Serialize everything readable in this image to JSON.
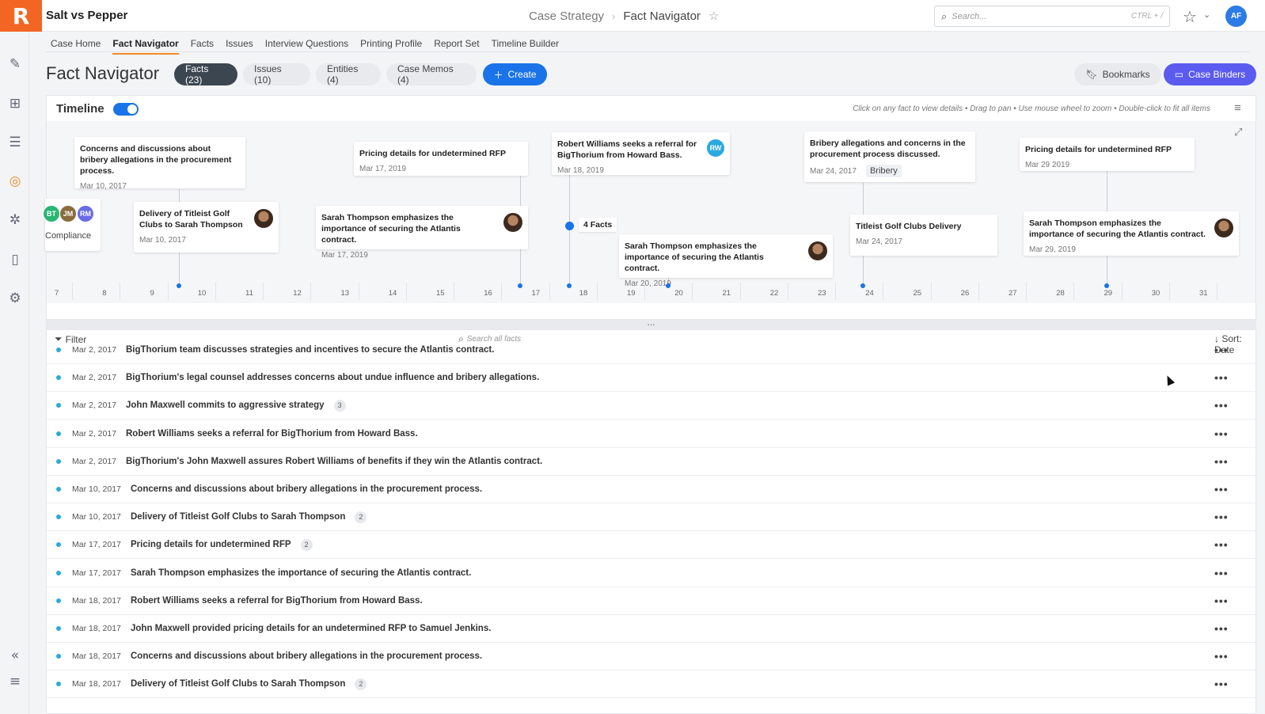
{
  "app": {
    "logo": "R",
    "title": "Salt vs Pepper"
  },
  "breadcrumb": {
    "parent": "Case Strategy",
    "current": "Fact Navigator"
  },
  "search": {
    "placeholder": "Search...",
    "shortcut": "CTRL + /"
  },
  "user": {
    "initials": "AF"
  },
  "nav_tabs": [
    "Case Home",
    "Fact Navigator",
    "Facts",
    "Issues",
    "Interview Questions",
    "Printing Profile",
    "Report Set",
    "Timeline Builder"
  ],
  "page": {
    "title": "Fact Navigator",
    "pills": [
      "Facts (23)",
      "Issues (10)",
      "Entities (4)",
      "Case Memos (4)"
    ],
    "create_label": "Create",
    "bookmarks_label": "Bookmarks",
    "binders_label": "Case Binders"
  },
  "timeline": {
    "title": "Timeline",
    "hint": "Click on any fact to view details • Drag to pan • Use mouse wheel to zoom • Double-click to fit all items",
    "partial_card": {
      "label": "Compliance",
      "avatars": [
        "BT",
        "JM",
        "RM"
      ]
    },
    "cards": [
      {
        "text": "Concerns and discussions about bribery allegations in the procurement process.",
        "date": "Mar 10, 2017"
      },
      {
        "text": "Delivery of Titleist Golf Clubs to Sarah Thompson",
        "date": "Mar 10, 2017"
      },
      {
        "text": "Pricing details for undetermined RFP",
        "date": "Mar 17, 2019"
      },
      {
        "text": "Sarah Thompson emphasizes the importance of securing the Atlantis contract.",
        "date": "Mar 17, 2019"
      },
      {
        "text": "Robert Williams seeks a referral for BigThorium from Howard Bass.",
        "date": "Mar 18, 2019",
        "avatar": "RW"
      },
      {
        "text": "Sarah Thompson emphasizes the importance of securing the Atlantis contract.",
        "date": "Mar 20, 2019"
      },
      {
        "text": "Bribery allegations and concerns in the procurement process discussed.",
        "date": "Mar 24, 2017",
        "tag": "Bribery"
      },
      {
        "text": "Titleist Golf Clubs Delivery",
        "date": "Mar 24, 2017"
      },
      {
        "text": "Pricing details for undetermined RFP",
        "date": "Mar 29 2019"
      },
      {
        "text": "Sarah Thompson emphasizes the importance of securing the Atlantis contract.",
        "date": "Mar 29, 2019"
      }
    ],
    "cluster_label": "4 Facts",
    "ticks": [
      "7",
      "8",
      "9",
      "10",
      "11",
      "12",
      "13",
      "14",
      "15",
      "16",
      "17",
      "18",
      "19",
      "20",
      "21",
      "22",
      "23",
      "24",
      "25",
      "26",
      "27",
      "28",
      "29",
      "30",
      "31"
    ]
  },
  "splitter_label": "...",
  "list": {
    "filter_label": "Filter",
    "search_placeholder": "Search all facts",
    "sort_label": "Sort: Date",
    "rows": [
      {
        "date": "Mar 2, 2017",
        "text": "BigThorium team discusses strategies and incentives to secure the Atlantis contract.",
        "badge": ""
      },
      {
        "date": "Mar 2, 2017",
        "text": "BigThorium's legal counsel addresses concerns about undue influence and bribery allegations.",
        "badge": ""
      },
      {
        "date": "Mar 2, 2017",
        "text": "John Maxwell commits to aggressive strategy",
        "badge": "3"
      },
      {
        "date": "Mar 2, 2017",
        "text": "Robert Williams seeks a referral for BigThorium from Howard Bass.",
        "badge": ""
      },
      {
        "date": "Mar 2, 2017",
        "text": "BigThorium's John Maxwell assures Robert Williams of benefits if they win the Atlantis contract.",
        "badge": ""
      },
      {
        "date": "Mar 10, 2017",
        "text": "Concerns and discussions about bribery allegations in the procurement process.",
        "badge": ""
      },
      {
        "date": "Mar 10, 2017",
        "text": "Delivery of Titleist Golf Clubs to Sarah Thompson",
        "badge": "2"
      },
      {
        "date": "Mar 17, 2017",
        "text": "Pricing details for undetermined RFP",
        "badge": "2"
      },
      {
        "date": "Mar 17, 2017",
        "text": "Sarah Thompson emphasizes the importance of securing the Atlantis contract.",
        "badge": ""
      },
      {
        "date": "Mar 18, 2017",
        "text": "Robert Williams seeks a referral for BigThorium from Howard Bass.",
        "badge": ""
      },
      {
        "date": "Mar 18, 2017",
        "text": "John Maxwell provided pricing details for an undetermined RFP to Samuel Jenkins.",
        "badge": ""
      },
      {
        "date": "Mar 18, 2017",
        "text": "Concerns and discussions about bribery allegations in the procurement process.",
        "badge": ""
      },
      {
        "date": "Mar 18, 2017",
        "text": "Delivery of Titleist Golf Clubs to Sarah Thompson",
        "badge": "2"
      }
    ]
  },
  "colors": {
    "accent": "#1a73e8",
    "brand": "#f26522",
    "binders": "#5b5bf0"
  }
}
